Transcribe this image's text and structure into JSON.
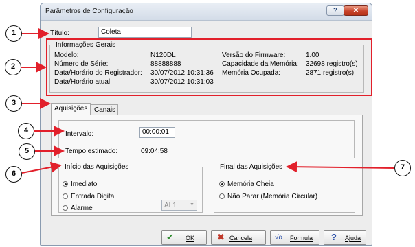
{
  "window": {
    "title": "Parâmetros de Configuração",
    "help_glyph": "?",
    "close_glyph": "✕"
  },
  "titulo": {
    "label": "Título:",
    "value": "Coleta"
  },
  "info": {
    "legend": "Informações Gerais",
    "rows_left": [
      {
        "label": "Modelo:",
        "value": "N120DL"
      },
      {
        "label": "Número de Série:",
        "value": "88888888"
      },
      {
        "label": "Data/Horário do Registrador:",
        "value": "30/07/2012 10:31:36"
      },
      {
        "label": "Data/Horário atual:",
        "value": "30/07/2012 10:31:03"
      }
    ],
    "rows_right": [
      {
        "label": "Versão do Firmware:",
        "value": "1.00"
      },
      {
        "label": "Capacidade da Memória:",
        "value": "32698 registro(s)"
      },
      {
        "label": "Memória Ocupada:",
        "value": "2871 registro(s)"
      }
    ]
  },
  "tabs": [
    {
      "label": "Aquisições",
      "active": true
    },
    {
      "label": "Canais",
      "active": false
    }
  ],
  "aquisicoes": {
    "intervalo_label": "Intervalo:",
    "intervalo_value": "00:00:01",
    "tempo_label": "Tempo estimado:",
    "tempo_value": "09:04:58",
    "inicio": {
      "legend": "Início das Aquisições",
      "options": [
        {
          "label": "Imediato",
          "selected": true
        },
        {
          "label": "Entrada Digital",
          "selected": false
        },
        {
          "label": "Alarme",
          "selected": false
        }
      ],
      "alarm_select": "AL1"
    },
    "final": {
      "legend": "Final das Aquisições",
      "options": [
        {
          "label": "Memória Cheia",
          "selected": true
        },
        {
          "label": "Não Parar (Memória Circular)",
          "selected": false
        }
      ]
    }
  },
  "buttons": {
    "ok": {
      "label": "OK",
      "icon": "check-icon",
      "glyph": "✔",
      "color": "#2e8b2e"
    },
    "cancela": {
      "label": "Cancela",
      "icon": "x-icon",
      "glyph": "✖",
      "color": "#c0392b"
    },
    "formula": {
      "label": "Formula",
      "icon": "sqrt-icon",
      "glyph": "√α",
      "color": "#2a4fa8"
    },
    "ajuda": {
      "label": "Ajuda",
      "icon": "question-icon",
      "glyph": "?",
      "color": "#2a4fa8"
    }
  },
  "annotations": {
    "bubbles": [
      "1",
      "2",
      "3",
      "4",
      "5",
      "6",
      "7"
    ],
    "color": "#e2202b"
  }
}
